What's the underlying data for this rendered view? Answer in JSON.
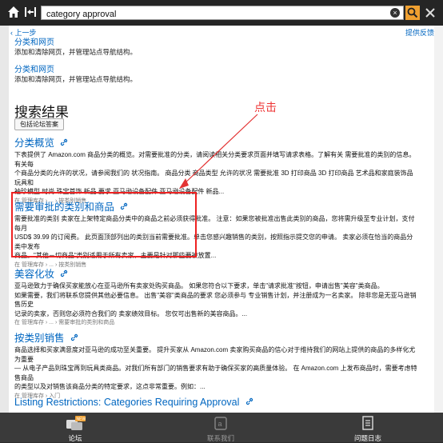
{
  "search": {
    "value": "category approval"
  },
  "nav": {
    "back_label": "‹ 上一步",
    "feedback_label": "提供反馈"
  },
  "top_items": [
    {
      "title": "分类和网页",
      "desc": "添加和清除网页，并管理站点导航结构。"
    },
    {
      "title": "分类和网页",
      "desc": "添加和清除网页，并管理站点导航结构。"
    }
  ],
  "results_header": "搜索结果",
  "include_forums_label": "包括论坛答案",
  "results": [
    {
      "title": "分类概览",
      "lines": [
        "下表提供了 Amazon.com 商品分类的概览。对需要批准的分类，请阅读相关分类要求页面并填写请求表格。了解有关 需要批准的类别的信息。 有关每",
        "个商品分类的允许的状况，请参阅我们的 状况指南。 商品分类 商品类型 允许的状况 需要批准 3D 打印商品 3D 打印商品 艺术品和家庭装饰品 玩具和",
        "袖珍模型 时尚 珠宝首饰 新品 要求 亚马逊设备配件 亚马逊设备配件 新品..."
      ],
      "crumb": "在 管理库存 › ... › 按类别销售"
    },
    {
      "title": "需要审批的类别和商品",
      "lines": [
        "需要批准的类别 卖家在上架特定商品分类中的商品之前必须获得批准。 注意：如果您被批准出售此类别的商品，您将需升级至专业计划，支付每月",
        "USD$ 39.99 的订阅费。 此页面顶部列出的类别当前需要批准。单击您感兴趣销售的类别，按照指示提交您的申请。 卖家必须在恰当的商品分类中发布",
        "商品。\"其他－切商品\"类别适用于所有卖家，主要是针对那些要被放置..."
      ],
      "crumb": "在 管理库存 › ... › 按类别销售"
    },
    {
      "title": "美容化妆",
      "lines": [
        "亚马逊致力于确保买家能放心在亚马逊所有卖家处购买商品。 如果您符合以下要求，单击\"请求批准\"按钮，申请出售\"美容\"类商品。",
        "如果需要，我们将联系您提供其他必要信息。 出售\"美容\"类商品的要求 您必须参与 专业销售计划，并注册成为一名卖家。 除非您是无亚马逊销售历史",
        "记录的卖家，否则您必须符合我们的 卖家绩效目标。 您仅可出售新的美容商品。..."
      ],
      "crumb": "在 管理库存 › ... › 需要审批的类别和商品"
    },
    {
      "title": "按类别销售",
      "lines": [
        "商品选择和买家满意度对亚马逊的成功至关重要。 提升买家从 Amazon.com 卖家购买商品的信心对于维持我们的网站上提供的商品的多样化尤为重要",
        "— 从电子产品到珠宝再到玩具类商品。对我们所有部门的销售要求有助于确保买家的高质量体验。 在 Amazon.com 上发布商品时，需要考虑特售商品",
        "的类型以及对销售该商品分类的特定要求，这点非常重要。例如：..."
      ],
      "crumb": "在 管理库存 › 入门"
    },
    {
      "title": "Listing Restrictions: Categories Requiring Approval",
      "lines": [],
      "crumb": ""
    }
  ],
  "annotation": {
    "text": "点击",
    "color": "#e33333"
  },
  "tabs": [
    {
      "label": "论坛",
      "icon": "forum-icon",
      "badge": "NEW",
      "active": true
    },
    {
      "label": "联系我们",
      "icon": "contact-icon",
      "active": false
    },
    {
      "label": "问题日志",
      "icon": "log-icon",
      "active": false
    }
  ],
  "colors": {
    "link": "#0066c0",
    "accent": "#f0a030",
    "annotation": "#e33333"
  }
}
